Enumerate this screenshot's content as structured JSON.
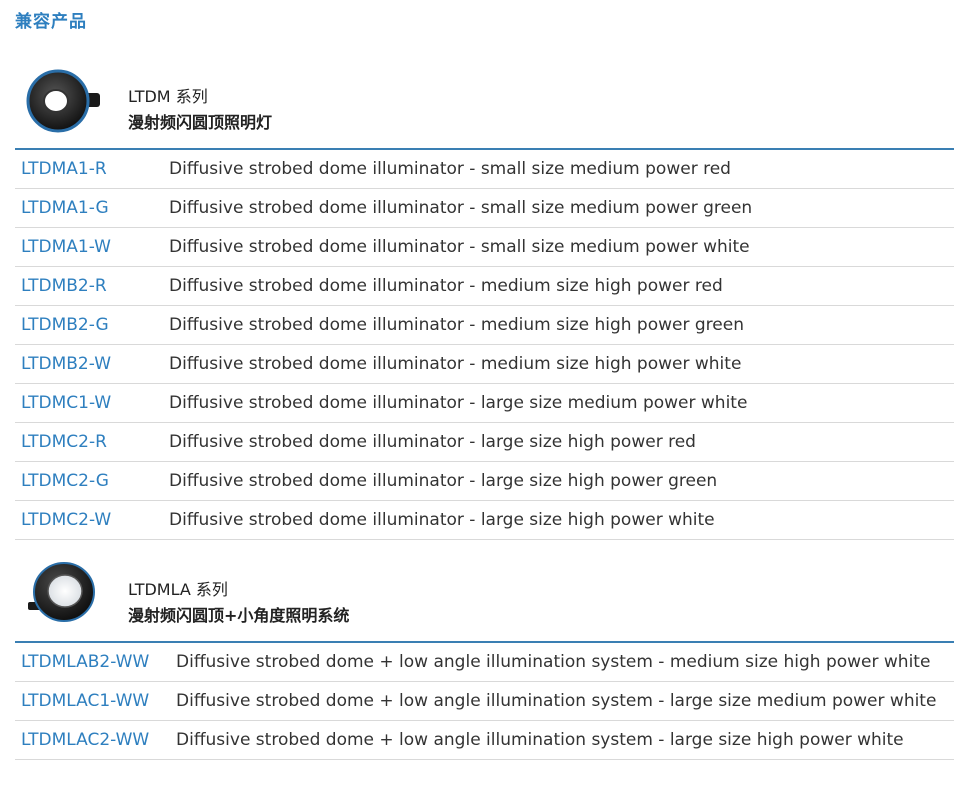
{
  "page_title": "兼容产品",
  "colors": {
    "accent": "#2e7fbf",
    "rule": "#3a7fb3",
    "divider": "#d9d9d9"
  },
  "sections": [
    {
      "series": "LTDM 系列",
      "subtitle": "漫射频闪圆顶照明灯",
      "image_icon": "ring-illuminator-thumbnail",
      "rows": [
        {
          "code": "LTDMA1-R",
          "desc": "Diffusive strobed dome illuminator - small size medium power red"
        },
        {
          "code": "LTDMA1-G",
          "desc": "Diffusive strobed dome illuminator - small size medium power green"
        },
        {
          "code": "LTDMA1-W",
          "desc": "Diffusive strobed dome illuminator - small size medium power white"
        },
        {
          "code": "LTDMB2-R",
          "desc": "Diffusive strobed dome illuminator - medium size high power red"
        },
        {
          "code": "LTDMB2-G",
          "desc": "Diffusive strobed dome illuminator - medium size high power green"
        },
        {
          "code": "LTDMB2-W",
          "desc": "Diffusive strobed dome illuminator - medium size high power white"
        },
        {
          "code": "LTDMC1-W",
          "desc": "Diffusive strobed dome illuminator - large size medium power white"
        },
        {
          "code": "LTDMC2-R",
          "desc": "Diffusive strobed dome illuminator - large size high power red"
        },
        {
          "code": "LTDMC2-G",
          "desc": "Diffusive strobed dome illuminator - large size high power green"
        },
        {
          "code": "LTDMC2-W",
          "desc": "Diffusive strobed dome illuminator - large size high power white"
        }
      ]
    },
    {
      "series": "LTDMLA 系列",
      "subtitle": "漫射频闪圆顶+小角度照明系统",
      "image_icon": "dome-illuminator-thumbnail",
      "rows": [
        {
          "code": "LTDMLAB2-WW",
          "desc": "Diffusive strobed dome + low angle illumination system - medium size high power white"
        },
        {
          "code": "LTDMLAC1-WW",
          "desc": "Diffusive strobed dome + low angle illumination system - large size medium power white"
        },
        {
          "code": "LTDMLAC2-WW",
          "desc": "Diffusive strobed dome + low angle illumination system - large size high power white"
        }
      ]
    }
  ]
}
